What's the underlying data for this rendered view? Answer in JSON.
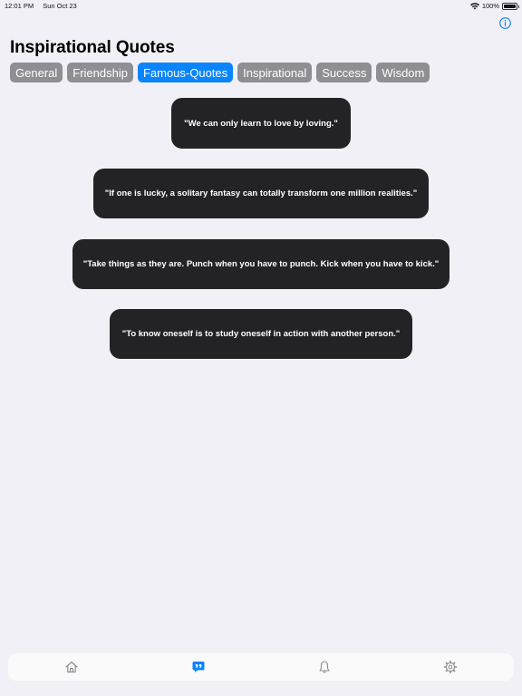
{
  "status_bar": {
    "time": "12:01 PM",
    "date": "Sun Oct 23",
    "battery_text": "100%",
    "battery_level": 1.0
  },
  "header": {
    "title": "Inspirational Quotes",
    "info_icon": "info-circle-icon"
  },
  "tabs": [
    {
      "label": "General",
      "active": false
    },
    {
      "label": "Friendship",
      "active": false
    },
    {
      "label": "Famous-Quotes",
      "active": true
    },
    {
      "label": "Inspirational",
      "active": false
    },
    {
      "label": "Success",
      "active": false
    },
    {
      "label": "Wisdom",
      "active": false
    }
  ],
  "quotes": [
    "\"We can only learn to love by loving.\"",
    "\"If one is lucky, a solitary fantasy can totally transform one million realities.\"",
    "\"Take things as they are. Punch when you have to punch. Kick when you have to kick.\"",
    "\"To know oneself is to study oneself in action with another person.\""
  ],
  "tab_bar": {
    "items": [
      {
        "icon": "house-icon",
        "selected": false
      },
      {
        "icon": "quote-bubble-icon",
        "selected": true
      },
      {
        "icon": "bell-icon",
        "selected": false
      },
      {
        "icon": "gear-icon",
        "selected": false
      }
    ]
  },
  "colors": {
    "accent": "#0a84ff",
    "background": "#f1f0f6",
    "tab_inactive": "#8e8e93",
    "card": "#232325",
    "icon_inactive": "#8e8e93"
  }
}
